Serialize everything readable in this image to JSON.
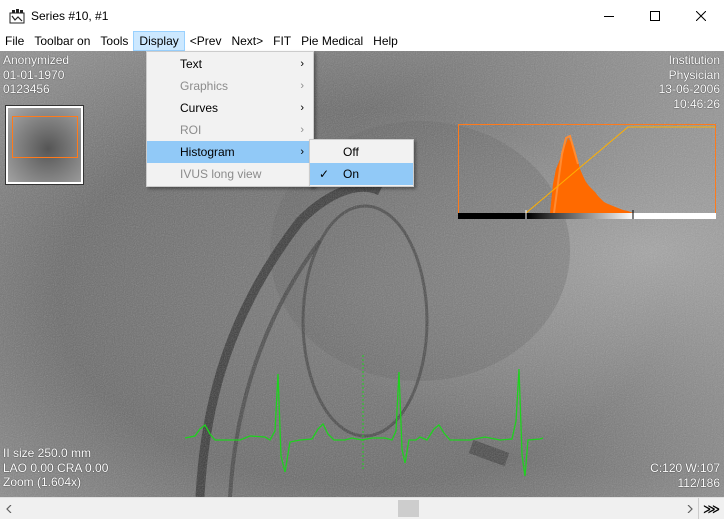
{
  "window": {
    "title": "Series #10, #1",
    "controls": {
      "minimize": "minimize-icon",
      "maximize": "maximize-icon",
      "close": "close-icon"
    }
  },
  "menubar": {
    "items": [
      "File",
      "Toolbar on",
      "Tools",
      "Display",
      "<Prev",
      "Next>",
      "FIT",
      "Pie Medical",
      "Help"
    ],
    "active": "Display"
  },
  "display_menu": {
    "items": [
      {
        "label": "Text",
        "submenu": true,
        "enabled": true
      },
      {
        "label": "Graphics",
        "submenu": true,
        "enabled": false
      },
      {
        "label": "Curves",
        "submenu": true,
        "enabled": true
      },
      {
        "label": "ROI",
        "submenu": true,
        "enabled": false
      },
      {
        "label": "Histogram",
        "submenu": true,
        "enabled": true,
        "highlighted": true
      },
      {
        "label": "IVUS long view",
        "submenu": false,
        "enabled": false
      }
    ]
  },
  "histogram_menu": {
    "items": [
      {
        "label": "Off",
        "checked": false
      },
      {
        "label": "On",
        "checked": true,
        "highlighted": true
      }
    ]
  },
  "overlay": {
    "top_left": [
      "Anonymized",
      "01-01-1970",
      "0123456"
    ],
    "top_right": [
      "Institution",
      "Physician",
      "13-06-2006",
      "10:46:26"
    ],
    "bottom_left": [
      "II size 250.0 mm",
      "LAO 0.00   CRA 0.00",
      "Zoom (1.604x)"
    ],
    "bottom_right": [
      "C:120 W:107",
      "112/186"
    ]
  },
  "colors": {
    "histogram": "#ff6a00",
    "ecg": "#1fd11f",
    "selection": "#91c9f7"
  },
  "scrollbar": {
    "next_label": "⋙"
  }
}
